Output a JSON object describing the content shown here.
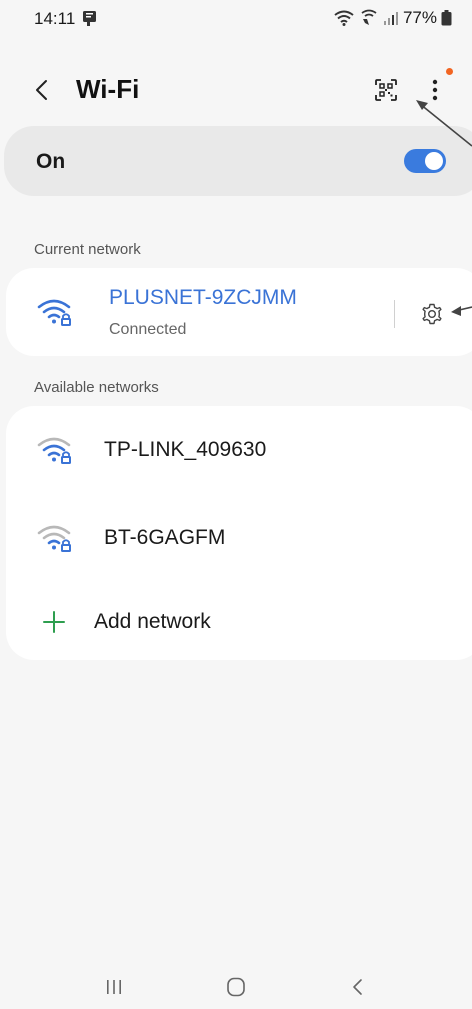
{
  "status_bar": {
    "time": "14:11",
    "battery": "77%",
    "icons": [
      "notification-icon",
      "wifi-status-icon",
      "wifi-calling-icon",
      "signal-icon",
      "battery-icon"
    ]
  },
  "header": {
    "title": "Wi-Fi",
    "back_icon": "chevron-left-icon",
    "qr_icon": "qr-code-icon",
    "more_icon": "more-vert-icon"
  },
  "toggle": {
    "label": "On",
    "state": "on"
  },
  "current_network": {
    "section_label": "Current network",
    "name": "PLUSNET-9ZCJMM",
    "status": "Connected",
    "settings_icon": "gear-icon"
  },
  "available_networks": {
    "section_label": "Available networks",
    "items": [
      {
        "name": "TP-LINK_409630",
        "icon": "wifi-lock-icon"
      },
      {
        "name": "BT-6GAGFM",
        "icon": "wifi-lock-icon"
      }
    ],
    "add_label": "Add network"
  },
  "colors": {
    "accent": "#3a73d6",
    "toggle": "#3a7bde",
    "add_icon": "#2e9e4f",
    "notification_dot": "#f26522",
    "background": "#f6f6f6"
  },
  "navbar": {
    "icons": [
      "recents-icon",
      "home-icon",
      "back-nav-icon"
    ]
  }
}
